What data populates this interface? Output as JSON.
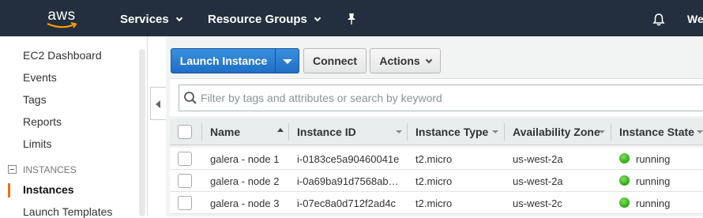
{
  "topnav": {
    "logo_text": "aws",
    "services_label": "Services",
    "resource_groups_label": "Resource Groups",
    "user_label": "Welcome"
  },
  "sidebar": {
    "items": [
      {
        "label": "EC2 Dashboard"
      },
      {
        "label": "Events"
      },
      {
        "label": "Tags"
      },
      {
        "label": "Reports"
      },
      {
        "label": "Limits"
      }
    ],
    "group_label": "INSTANCES",
    "active_item": "Instances",
    "next_item": "Launch Templates"
  },
  "toolbar": {
    "launch_label": "Launch Instance",
    "connect_label": "Connect",
    "actions_label": "Actions"
  },
  "search": {
    "placeholder": "Filter by tags and attributes or search by keyword"
  },
  "table": {
    "columns": [
      "Name",
      "Instance ID",
      "Instance Type",
      "Availability Zone",
      "Instance State"
    ],
    "rows": [
      {
        "name": "galera - node 1",
        "id": "i-0183ce5a90460041e",
        "type": "t2.micro",
        "zone": "us-west-2a",
        "state": "running"
      },
      {
        "name": "galera - node 2",
        "id": "i-0a69ba91d7568ab…",
        "type": "t2.micro",
        "zone": "us-west-2a",
        "state": "running"
      },
      {
        "name": "galera - node 3",
        "id": "i-07ec8a0d712f2ad4c",
        "type": "t2.micro",
        "zone": "us-west-2c",
        "state": "running"
      }
    ]
  },
  "colors": {
    "nav_bg": "#232f3e",
    "primary": "#1f6fc6",
    "accent": "#ec7211",
    "running": "#2ea714"
  }
}
